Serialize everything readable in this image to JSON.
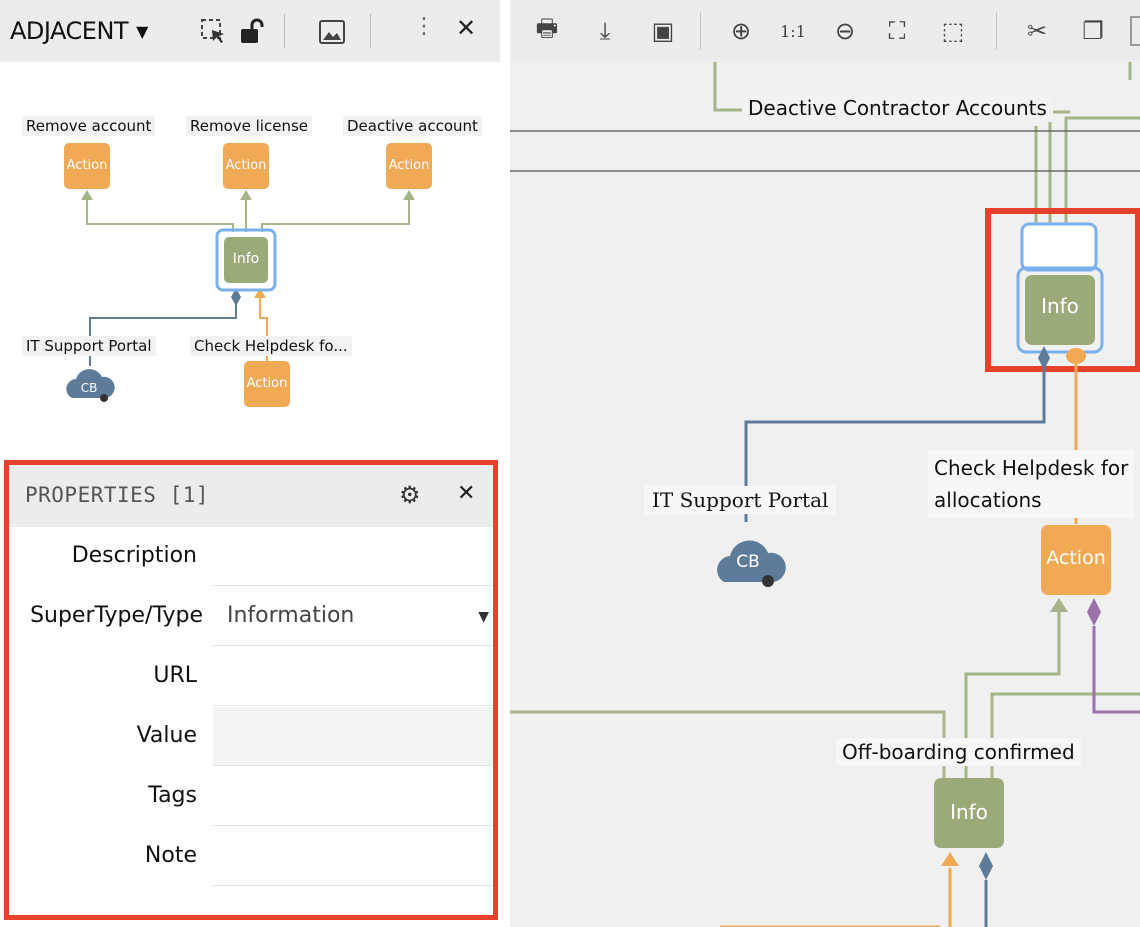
{
  "adjacent_panel": {
    "title": "ADJACENT",
    "nodes": {
      "remove_account": {
        "label": "Remove account",
        "box": "Action"
      },
      "remove_license": {
        "label": "Remove license",
        "box": "Action"
      },
      "deactive_account": {
        "label": "Deactive account",
        "box": "Action"
      },
      "center": {
        "box": "Info"
      },
      "it_portal": {
        "label": "IT Support Portal",
        "box": "CB"
      },
      "check_helpdesk": {
        "label": "Check Helpdesk fo...",
        "box": "Action"
      }
    }
  },
  "properties": {
    "title": "PROPERTIES [1]",
    "rows": [
      {
        "label": "Description",
        "value": ""
      },
      {
        "label": "SuperType/Type",
        "value": "Information"
      },
      {
        "label": "URL",
        "value": ""
      },
      {
        "label": "Value",
        "value": ""
      },
      {
        "label": "Tags",
        "value": ""
      },
      {
        "label": "Note",
        "value": ""
      }
    ]
  },
  "toolbar": {
    "items": [
      {
        "name": "print-icon",
        "glyph": "🖶"
      },
      {
        "name": "download-icon",
        "glyph": "⤓"
      },
      {
        "name": "image-icon",
        "glyph": "▣"
      },
      {
        "name": "zoom-in-icon",
        "glyph": "⊕"
      },
      {
        "name": "actual-size-icon",
        "glyph": "1:1"
      },
      {
        "name": "zoom-out-icon",
        "glyph": "⊖"
      },
      {
        "name": "fit-icon",
        "glyph": "⛶"
      },
      {
        "name": "select-area-icon",
        "glyph": "⬚"
      },
      {
        "name": "cut-icon",
        "glyph": "✂"
      },
      {
        "name": "copy-icon",
        "glyph": "❐"
      }
    ]
  },
  "canvas": {
    "deactive_contractor": "Deactive Contractor Accounts",
    "info_selected": "Info",
    "it_portal": "IT Support Portal",
    "cb": "CB",
    "check_helpdesk_line1": "Check Helpdesk for",
    "check_helpdesk_line2": "allocations",
    "action": "Action",
    "offboarding": "Off-boarding confirmed",
    "info_bottom": "Info"
  },
  "colors": {
    "action": "#f0a955",
    "info": "#9aaa78",
    "cloud": "#5f7b9a",
    "edge_green": "#a6b489",
    "edge_blue": "#5f7b9a",
    "edge_orange": "#f0a955",
    "edge_purple": "#9b72aa",
    "highlight": "#e8412b",
    "selection": "#7ab0ee"
  }
}
